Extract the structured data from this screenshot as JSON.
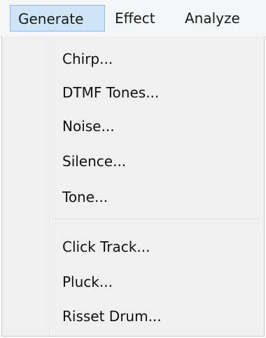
{
  "menubar": {
    "items": [
      {
        "label": "Generate",
        "active": true
      },
      {
        "label": "Effect"
      },
      {
        "label": "Analyze"
      }
    ]
  },
  "menu": {
    "group1": [
      "Chirp...",
      "DTMF Tones...",
      "Noise...",
      "Silence...",
      "Tone..."
    ],
    "group2": [
      "Click Track...",
      "Pluck...",
      "Risset Drum..."
    ]
  },
  "colors": {
    "active_highlight": "#cde5f7",
    "active_border": "#8fbfe6",
    "menu_background": "#f0f0f0"
  }
}
